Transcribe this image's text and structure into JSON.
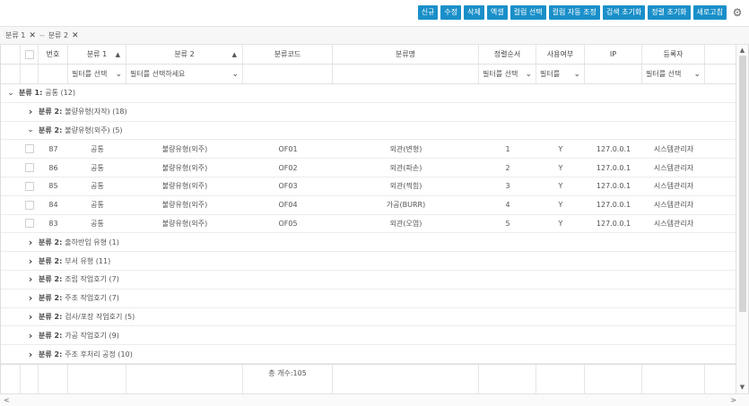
{
  "toolbar": {
    "buttons": [
      "신규",
      "수정",
      "삭제",
      "엑셀",
      "컬럼 선택",
      "컬럼 자동 조정",
      "검색 초기화",
      "정렬 초기화",
      "새로고침"
    ],
    "settings_icon": "gear-icon"
  },
  "group_bar": {
    "chips": [
      "분류 1",
      "분류 2"
    ],
    "separator": "--"
  },
  "columns": [
    {
      "key": "expand",
      "label": ""
    },
    {
      "key": "check",
      "label": ""
    },
    {
      "key": "no",
      "label": "번호"
    },
    {
      "key": "cat1",
      "label": "분류 1",
      "sort": "▲"
    },
    {
      "key": "cat2",
      "label": "분류 2",
      "sort": "▲"
    },
    {
      "key": "code",
      "label": "분류코드"
    },
    {
      "key": "name",
      "label": "분류명"
    },
    {
      "key": "order",
      "label": "정렬순서"
    },
    {
      "key": "use",
      "label": "사용여부"
    },
    {
      "key": "ip",
      "label": "IP"
    },
    {
      "key": "reg",
      "label": "등록자"
    }
  ],
  "filters": {
    "cat1": "필터를 선택",
    "cat2": "필터를 선택하세요",
    "order": "필터를 선택",
    "use": "필터를",
    "reg": "필터를 선택"
  },
  "rows": [
    {
      "type": "group1",
      "label": "분류 1:",
      "value": "공통 (12)",
      "state": "expanded"
    },
    {
      "type": "group2",
      "label": "분류 2:",
      "value": "불량유형(자작) (18)",
      "state": "collapsed"
    },
    {
      "type": "group2",
      "label": "분류 2:",
      "value": "불량유형(외주) (5)",
      "state": "expanded"
    },
    {
      "type": "data",
      "no": "87",
      "cat1": "공통",
      "cat2": "불량유형(외주)",
      "code": "OF01",
      "name": "외관(변형)",
      "order": "1",
      "use": "Y",
      "ip": "127.0.0.1",
      "reg": "시스템관리자"
    },
    {
      "type": "data",
      "no": "86",
      "cat1": "공통",
      "cat2": "불량유형(외주)",
      "code": "OF02",
      "name": "외관(파손)",
      "order": "2",
      "use": "Y",
      "ip": "127.0.0.1",
      "reg": "시스템관리자"
    },
    {
      "type": "data",
      "no": "85",
      "cat1": "공통",
      "cat2": "불량유형(외주)",
      "code": "OF03",
      "name": "외관(찍힘)",
      "order": "3",
      "use": "Y",
      "ip": "127.0.0.1",
      "reg": "시스템관리자"
    },
    {
      "type": "data",
      "no": "84",
      "cat1": "공통",
      "cat2": "불량유형(외주)",
      "code": "OF04",
      "name": "가공(BURR)",
      "order": "4",
      "use": "Y",
      "ip": "127.0.0.1",
      "reg": "시스템관리자"
    },
    {
      "type": "data",
      "no": "83",
      "cat1": "공통",
      "cat2": "불량유형(외주)",
      "code": "OF05",
      "name": "외관(오염)",
      "order": "5",
      "use": "Y",
      "ip": "127.0.0.1",
      "reg": "시스템관리자"
    },
    {
      "type": "group2",
      "label": "분류 2:",
      "value": "출하반입 유형 (1)",
      "state": "collapsed"
    },
    {
      "type": "group2",
      "label": "분류 2:",
      "value": "부서 유형 (11)",
      "state": "collapsed"
    },
    {
      "type": "group2",
      "label": "분류 2:",
      "value": "조립 작업호기 (7)",
      "state": "collapsed"
    },
    {
      "type": "group2",
      "label": "분류 2:",
      "value": "주조 작업호기 (7)",
      "state": "collapsed"
    },
    {
      "type": "group2",
      "label": "분류 2:",
      "value": "검사/포장 작업호기 (5)",
      "state": "collapsed"
    },
    {
      "type": "group2",
      "label": "분류 2:",
      "value": "가공 작업호기 (9)",
      "state": "collapsed"
    },
    {
      "type": "group2",
      "label": "분류 2:",
      "value": "주조 후처리 공정 (10)",
      "state": "collapsed"
    }
  ],
  "footer": {
    "total": "총 개수:105"
  },
  "scroll": {
    "up": "▲",
    "down": "▼",
    "left": "<",
    "right": ">"
  }
}
